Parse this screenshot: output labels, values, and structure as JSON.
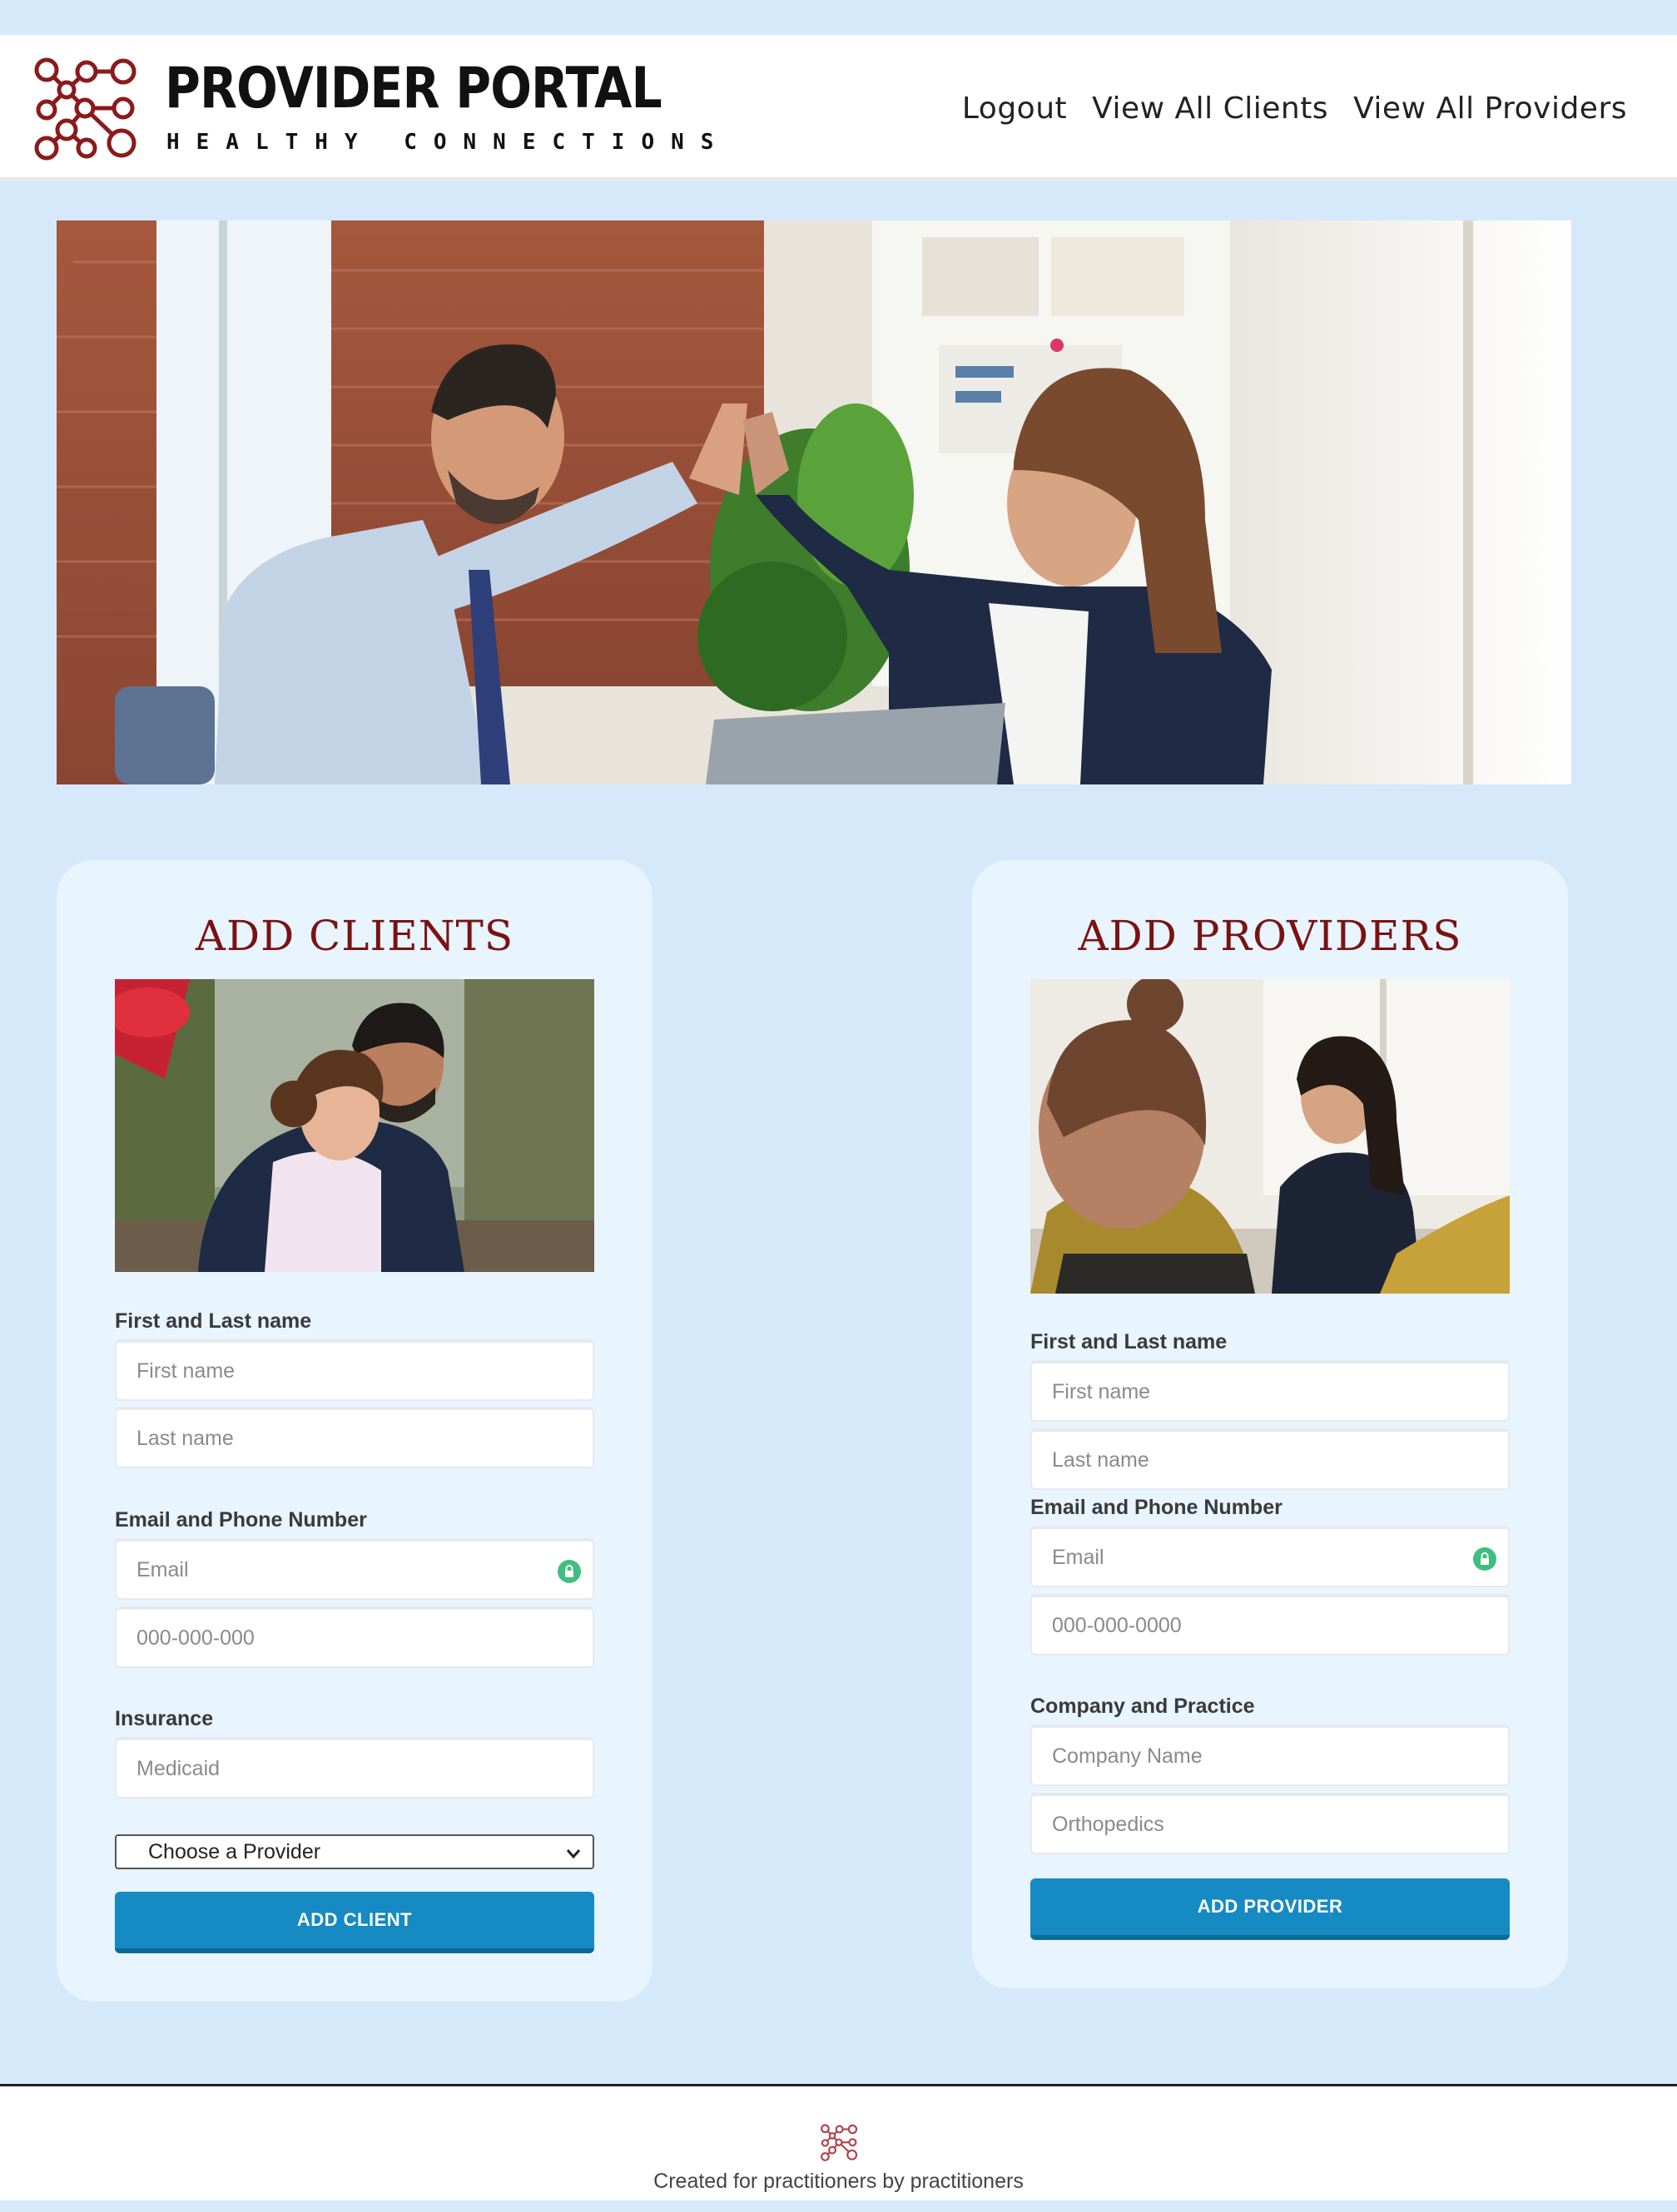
{
  "header": {
    "brand_title": "PROVIDER PORTAL",
    "brand_subtitle": "HEALTHY CONNECTIONS",
    "logo_icon": "molecule-network-icon",
    "nav": [
      {
        "label": "Logout"
      },
      {
        "label": "View All Clients"
      },
      {
        "label": "View All Providers"
      }
    ]
  },
  "hero": {
    "image": "office-high-five-photo"
  },
  "clients_card": {
    "title": "ADD CLIENTS",
    "image": "father-and-daughter-photo",
    "name_label": "First and Last name",
    "first_name_placeholder": "First name",
    "last_name_placeholder": "Last name",
    "contact_label": "Email and Phone Number",
    "email_placeholder": "Email",
    "phone_placeholder": "000-000-000",
    "insurance_label": "Insurance",
    "insurance_placeholder": "Medicaid",
    "provider_select": "Choose a Provider",
    "submit_label": "ADD CLIENT"
  },
  "providers_card": {
    "title": "ADD PROVIDERS",
    "image": "coworkers-meeting-photo",
    "name_label": "First and Last name",
    "first_name_placeholder": "First name",
    "last_name_placeholder": "Last name",
    "contact_label": "Email and Phone Number",
    "email_placeholder": "Email",
    "phone_placeholder": "000-000-0000",
    "company_label": "Company and Practice",
    "company_placeholder": "Company Name",
    "practice_placeholder": "Orthopedics",
    "submit_label": "ADD PROVIDER"
  },
  "footer": {
    "text": "Created for practitioners by practitioners",
    "icon": "molecule-network-icon"
  },
  "colors": {
    "page_bg": "#d6e9fb",
    "card_bg": "#e8f4fe",
    "title_red": "#7a1212",
    "button_blue": "#168ac2",
    "lock_green": "#3fbf7f"
  }
}
